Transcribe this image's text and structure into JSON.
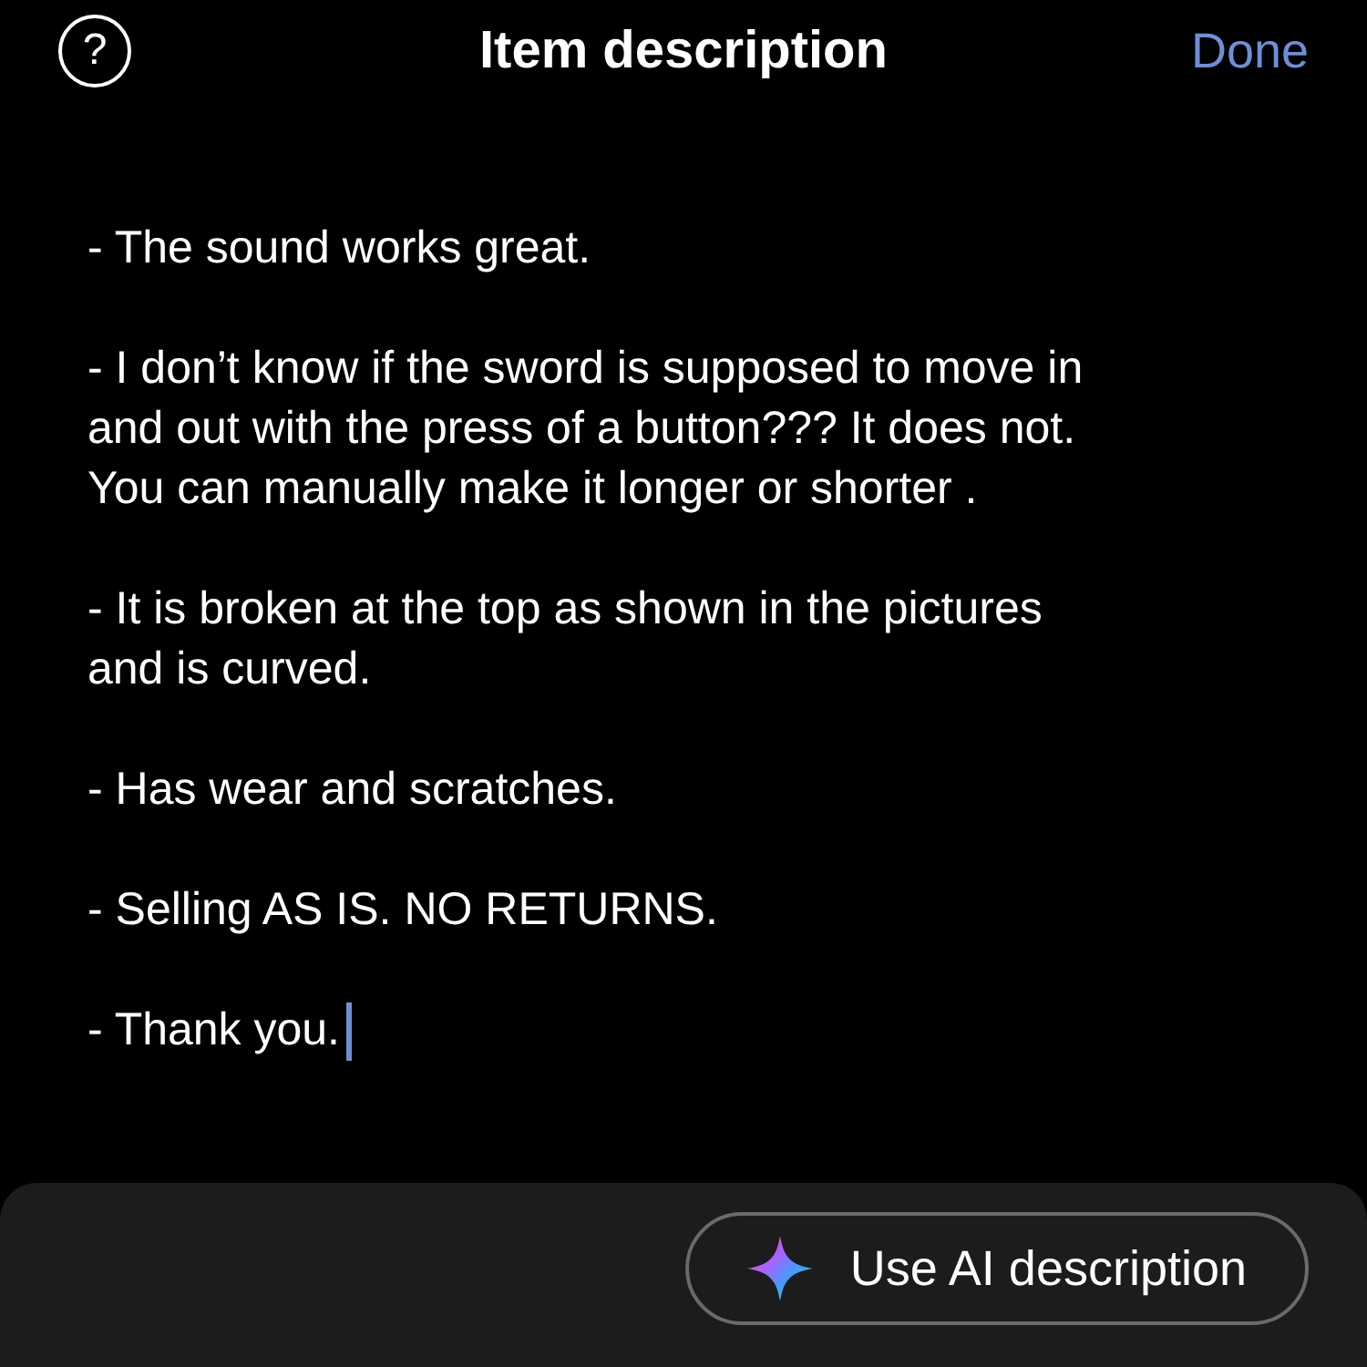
{
  "header": {
    "help_icon": "?",
    "title": "Item description",
    "done": "Done"
  },
  "description": {
    "paragraphs": [
      [
        "- The sound works great."
      ],
      [
        "- I don’t know if the sword is supposed to move in",
        "and out with the press of a button??? It does not.",
        "You can manually make it longer or shorter ."
      ],
      [
        "- It is broken at the top as shown in the pictures",
        "and is curved."
      ],
      [
        "- Has wear and scratches."
      ],
      [
        "- Selling AS IS. NO RETURNS."
      ],
      [
        "- Thank you."
      ]
    ]
  },
  "ai_button": {
    "label": "Use AI description"
  }
}
